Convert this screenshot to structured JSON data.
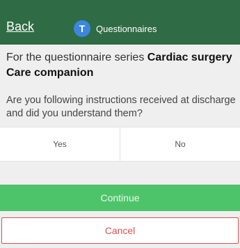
{
  "header": {
    "back_label": "Back",
    "avatar_initial": "T",
    "title": "Questionnaires"
  },
  "series": {
    "prefix": "For the questionnaire series",
    "name": "Cardiac surgery Care companion"
  },
  "question": {
    "text": "Are you following instructions received at discharge and did you understand them?"
  },
  "answers": {
    "yes_label": "Yes",
    "no_label": "No"
  },
  "actions": {
    "continue_label": "Continue",
    "cancel_label": "Cancel"
  },
  "colors": {
    "header_bg": "#2f6b44",
    "avatar_bg": "#3b87e0",
    "continue_bg": "#4ec46a",
    "cancel_color": "#d9534f"
  }
}
